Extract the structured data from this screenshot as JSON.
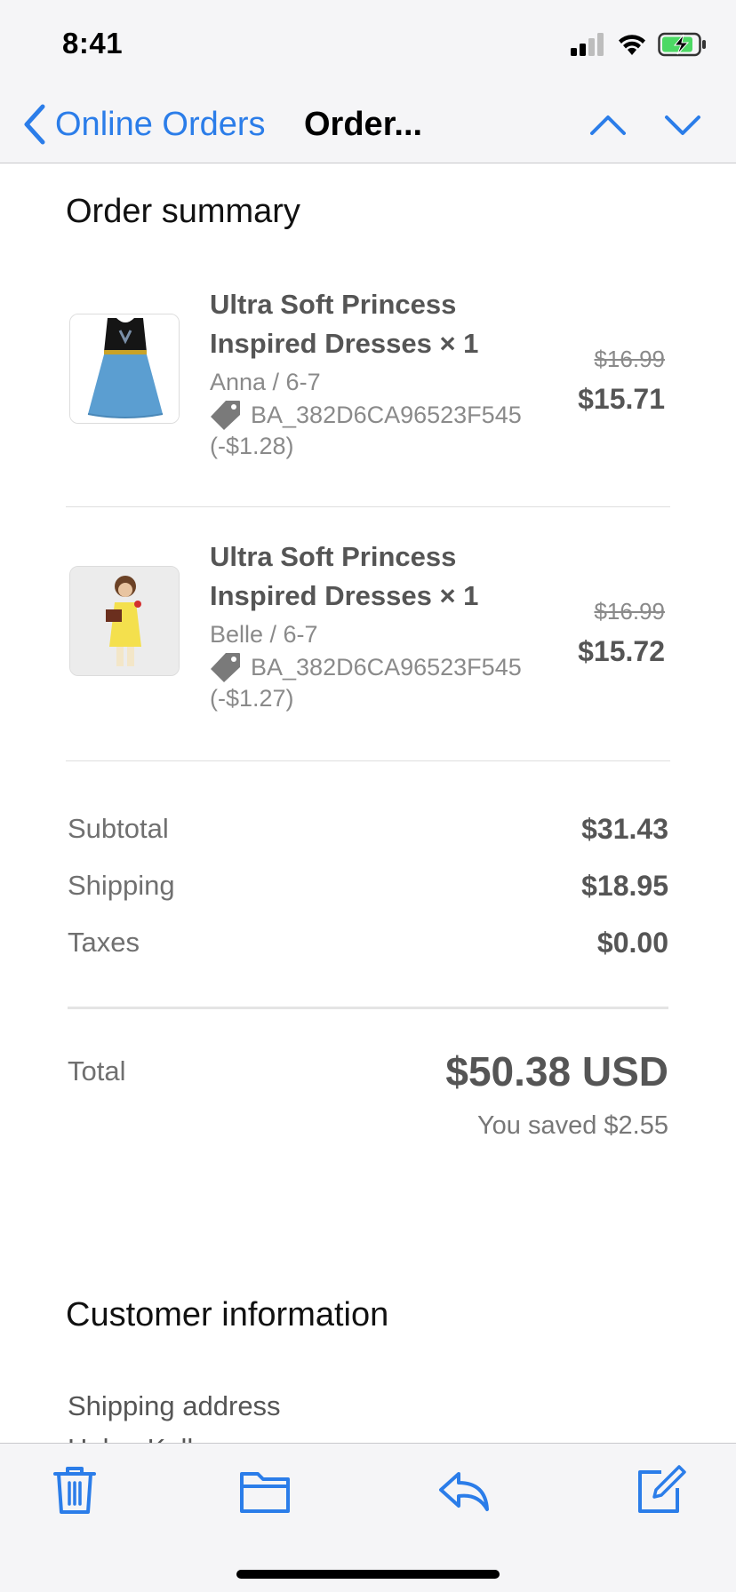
{
  "status_bar": {
    "time": "8:41"
  },
  "nav": {
    "back_label": "Online Orders",
    "title": "Order..."
  },
  "order_summary": {
    "heading": "Order summary",
    "items": [
      {
        "name": "Ultra Soft Princess Inspired Dresses × 1",
        "variant": "Anna / 6-7",
        "discount_code": "BA_382D6CA96523F545",
        "discount_amount": "(-$1.28)",
        "original_price": "$16.99",
        "price": "$15.71",
        "thumbnail": "anna-dress-image"
      },
      {
        "name": "Ultra Soft Princess Inspired Dresses × 1",
        "variant": "Belle / 6-7",
        "discount_code": "BA_382D6CA96523F545",
        "discount_amount": "(-$1.27)",
        "original_price": "$16.99",
        "price": "$15.72",
        "thumbnail": "belle-dress-image"
      }
    ],
    "subtotal_label": "Subtotal",
    "subtotal": "$31.43",
    "shipping_label": "Shipping",
    "shipping": "$18.95",
    "taxes_label": "Taxes",
    "taxes": "$0.00",
    "total_label": "Total",
    "total": "$50.38 USD",
    "saved": "You saved $2.55"
  },
  "customer_info": {
    "heading": "Customer information",
    "shipping_address_label": "Shipping address",
    "address_line_partial": "Helen Kell"
  },
  "toolbar": {
    "icons": [
      "trash-icon",
      "folder-icon",
      "reply-icon",
      "compose-icon"
    ]
  },
  "colors": {
    "accent": "#2b7de9",
    "bar_background": "#f5f5f7",
    "text_muted": "#8a8a8a",
    "text_strong": "#555555"
  }
}
